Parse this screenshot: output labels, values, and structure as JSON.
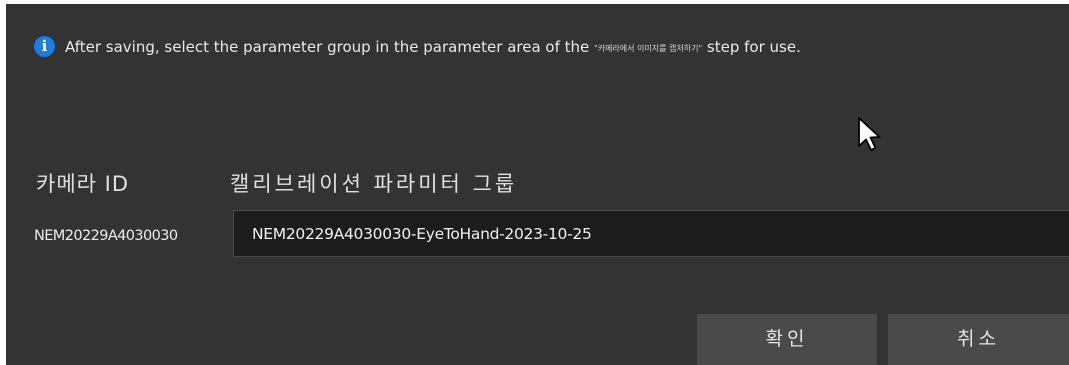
{
  "info": {
    "icon": "info-icon",
    "glyph": "i",
    "text_before": "After saving, select the parameter group in the parameter area of the ",
    "step_name": "\"카메라에서 이미지를 캡처하기\"",
    "text_after": " step for use.",
    "accent_color": "#1e7be0"
  },
  "columns": {
    "camera_id": "카메라 ID",
    "parameter_group": "캘리브레이션 파라미터 그룹"
  },
  "row": {
    "camera_id": "NEM20229A4030030",
    "parameter_group_value": "NEM20229A4030030-EyeToHand-2023-10-25"
  },
  "buttons": {
    "ok": "확인",
    "cancel": "취소"
  }
}
